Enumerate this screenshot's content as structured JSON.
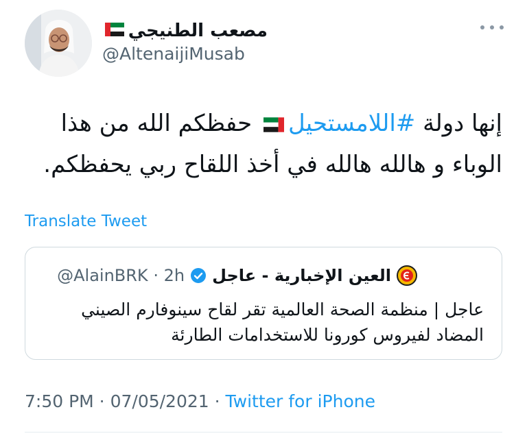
{
  "author": {
    "display_name": "مصعب الطنيجي",
    "handle": "@AltenaijiMusab"
  },
  "tweet": {
    "line1_start": "إنها دولة ",
    "hashtag": "#اللامستحيل",
    "line1_end": " حفظكم الله من هذا",
    "line2": "الوباء و هالله هالله في أخذ اللقاح ربي يحفظكم."
  },
  "translate_label": "Translate Tweet",
  "quoted": {
    "name": "العين الإخبارية - عاجل",
    "handle": "@AlainBRK",
    "separator": "·",
    "time": "2h",
    "avatar_label": "عاجل",
    "text_line1": "عاجل | منظمة الصحة العالمية تقر لقاح سينوفارم الصيني",
    "text_line2": "المضاد لفيروس كورونا للاستخدامات الطارئة"
  },
  "meta": {
    "time": "7:50 PM",
    "date": "07/05/2021",
    "sep1": " · ",
    "sep2": " · ",
    "source": "Twitter for iPhone"
  },
  "colors": {
    "accent": "#1d9bf0",
    "muted": "#536471",
    "text": "#0f1419",
    "border": "#cfd9de"
  },
  "icons": {
    "more": "more-horizontal-icon",
    "verified": "verified-badge-icon",
    "flag": "uae-flag-icon"
  }
}
